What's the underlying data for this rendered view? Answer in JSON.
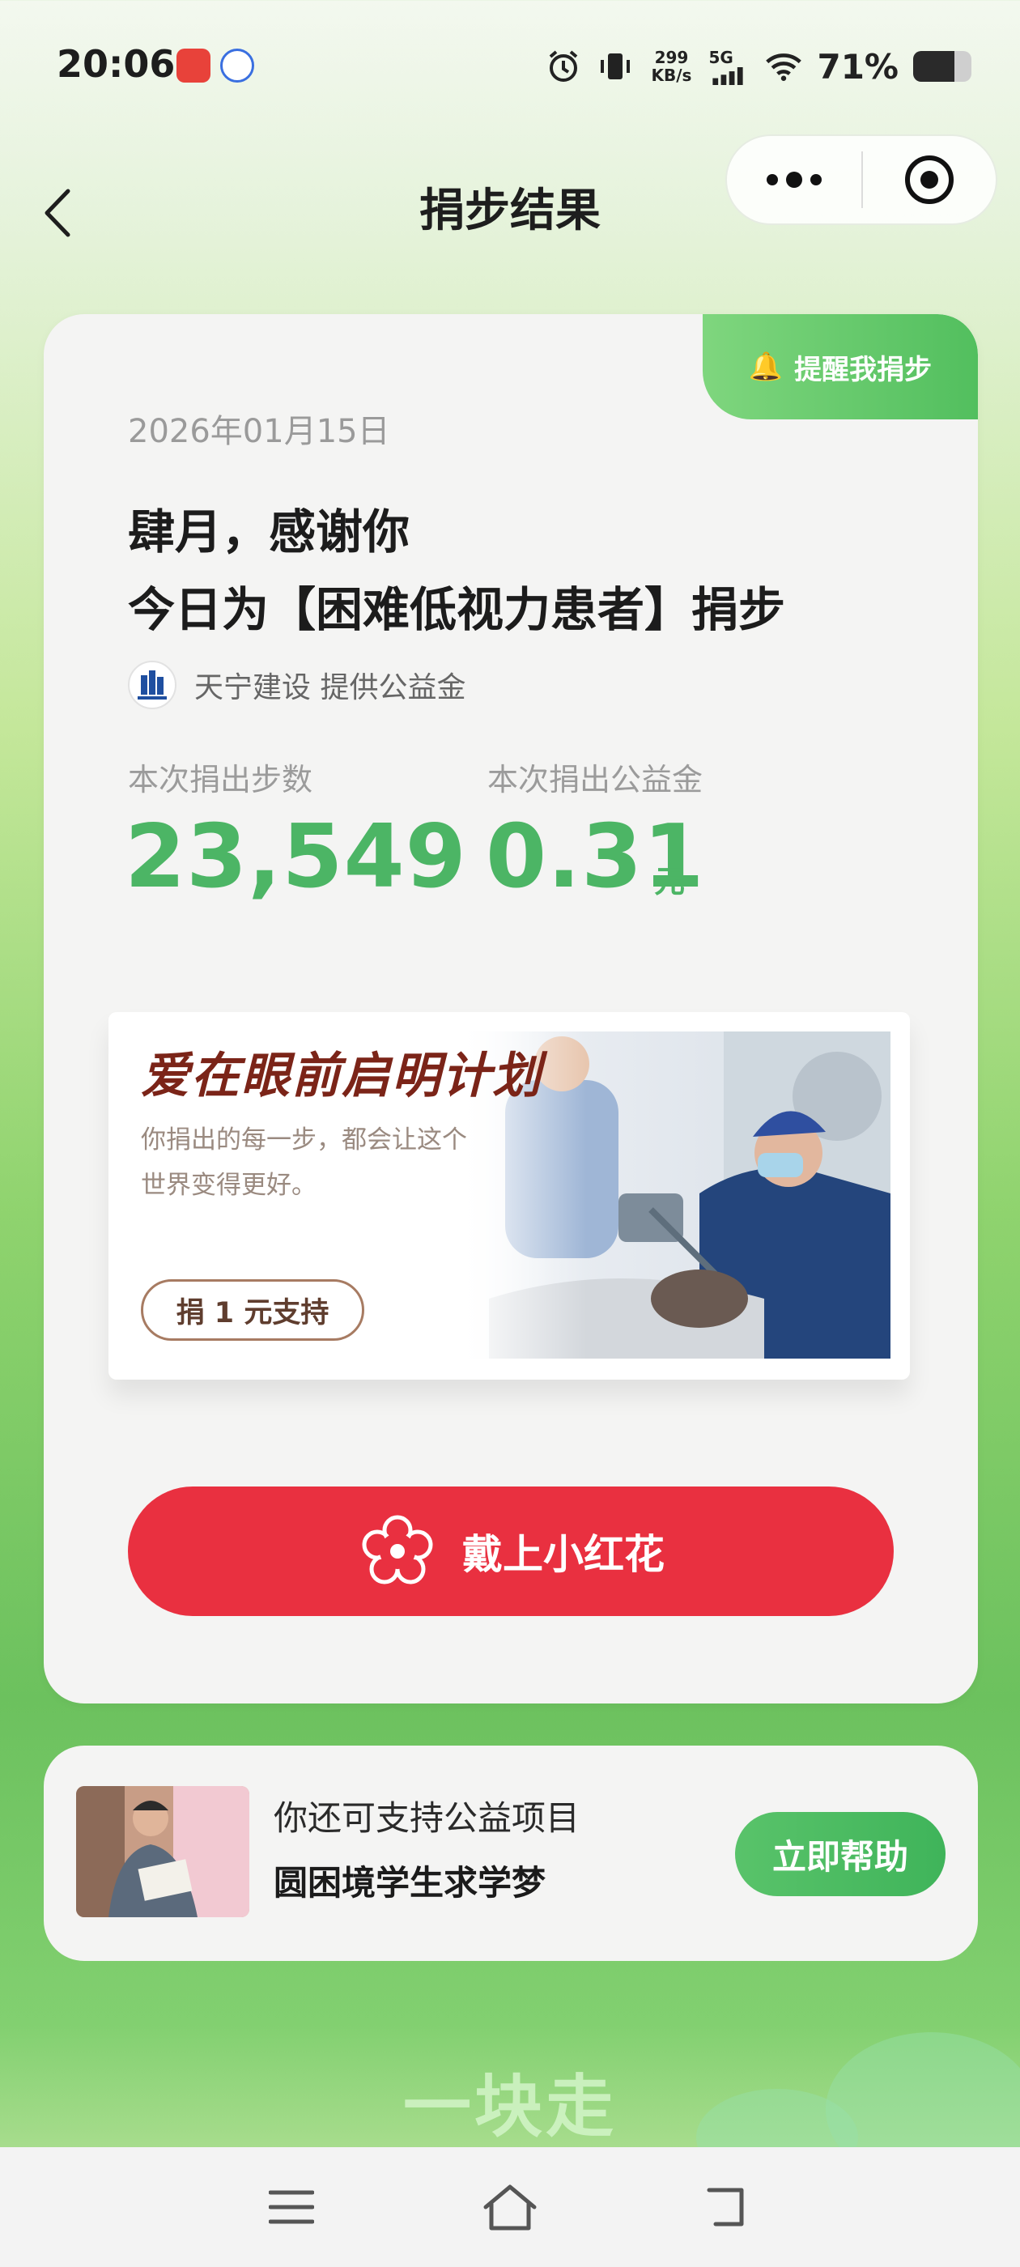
{
  "status_bar": {
    "time": "20:06",
    "net_speed_value": "299",
    "net_speed_unit": "KB/s",
    "net_type": "5G",
    "battery_percent": "71%",
    "battery_level": 0.71
  },
  "nav": {
    "title": "捐步结果"
  },
  "card": {
    "remind_label": "提醒我捐步",
    "date": "2026年01月15日",
    "thanks_line1": "肆月，感谢你",
    "thanks_line2": "今日为【困难低视力患者】捐步",
    "sponsor": "天宁建设 提供公益金",
    "steps_label": "本次捐出步数",
    "steps_value": "23,549",
    "fund_label": "本次捐出公益金",
    "fund_value": "0.31",
    "fund_unit": "元"
  },
  "banner": {
    "title": "爱在眼前启明计划",
    "description": "你捐出的每一步，都会让这个世界变得更好。",
    "button_label": "捐 1 元支持"
  },
  "flower_button_label": "戴上小红花",
  "sub_card": {
    "label": "你还可支持公益项目",
    "project_name": "圆困境学生求学梦",
    "button_label": "立即帮助"
  },
  "slogan": "一块走",
  "colors": {
    "accent_green": "#4cb565",
    "flower_red": "#e93040",
    "banner_brown": "#7b2418"
  }
}
